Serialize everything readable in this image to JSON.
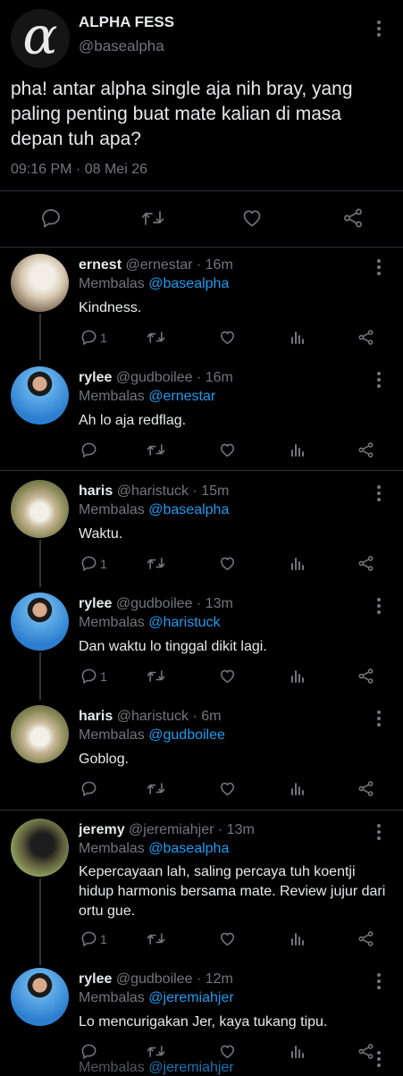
{
  "main_tweet": {
    "name": "ALPHA FESS",
    "handle": "@basealpha",
    "avatar_glyph": "α",
    "text": "pha! antar alpha single aja nih bray, yang paling penting buat mate kalian di masa depan tuh apa?",
    "time": "09:16 PM",
    "separator": "·",
    "date": "08 Mei 26",
    "actions": [
      "reply-icon",
      "retweet-icon",
      "like-icon",
      "share-icon"
    ]
  },
  "replies": [
    {
      "name": "ernest",
      "handle": "@ernestar",
      "time": "16m",
      "replying_label": "Membalas",
      "replying_to": "@basealpha",
      "text": "Kindness.",
      "reply_count": "1"
    },
    {
      "name": "rylee",
      "handle": "@gudboilee",
      "time": "16m",
      "replying_label": "Membalas",
      "replying_to": "@ernestar",
      "text": "Ah lo aja redflag.",
      "reply_count": ""
    },
    {
      "name": "haris",
      "handle": "@haristuck",
      "time": "15m",
      "replying_label": "Membalas",
      "replying_to": "@basealpha",
      "text": "Waktu.",
      "reply_count": "1"
    },
    {
      "name": "rylee",
      "handle": "@gudboilee",
      "time": "13m",
      "replying_label": "Membalas",
      "replying_to": "@haristuck",
      "text": "Dan waktu lo tinggal dikit lagi.",
      "reply_count": "1"
    },
    {
      "name": "haris",
      "handle": "@haristuck",
      "time": "6m",
      "replying_label": "Membalas",
      "replying_to": "@gudboilee",
      "text": "Goblog.",
      "reply_count": ""
    },
    {
      "name": "jeremy",
      "handle": "@jeremiahjer",
      "time": "13m",
      "replying_label": "Membalas",
      "replying_to": "@basealpha",
      "text": "Kepercayaan lah, saling percaya tuh koentji hidup harmonis bersama mate. Review jujur dari ortu gue.",
      "reply_count": "1"
    },
    {
      "name": "rylee",
      "handle": "@gudboilee",
      "time": "12m",
      "replying_label": "Membalas",
      "replying_to": "@jeremiahjer",
      "text": "Lo mencurigakan Jer, kaya tukang tipu.",
      "reply_count": ""
    }
  ],
  "partial_next": {
    "replying_label": "Membalas",
    "replying_to": "@jeremiahjer"
  },
  "colors": {
    "background": "#000000",
    "text": "#e7e9ea",
    "muted": "#71767b",
    "accent": "#1d9bf0",
    "divider": "#2f3336"
  }
}
